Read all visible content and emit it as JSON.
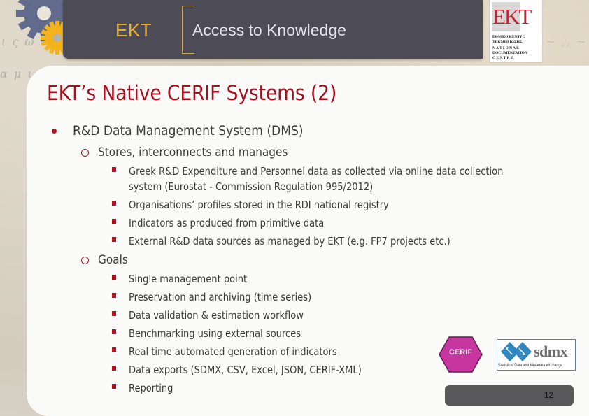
{
  "header": {
    "org_short": "EKT",
    "tagline": "Access to Knowledge"
  },
  "logo": {
    "mark": "EKT",
    "lines": [
      "ΕΘΝΙΚΟ ΚΕΝΤΡΟ",
      "ΤΕΚΜΗΡΙΩΣΗΣ",
      "N A T I O N A L",
      "DOCUMENTATION",
      "C E N T R E"
    ]
  },
  "slide": {
    "title": "EKT’s Native CERIF Systems (2)",
    "bullet": "R&D Data Management System (DMS)",
    "sections": [
      {
        "heading": "Stores, interconnects and manages",
        "items": [
          "Greek R&D Expenditure and Personnel data as collected via online data collection",
          "system (Eurostat - Commission Regulation 995/2012)",
          "Organisations’ profiles stored in the RDI national registry",
          "Indicators as produced from primitive data",
          "External R&D data sources as managed by EKT (e.g. FP7 projects etc.)"
        ]
      },
      {
        "heading": "Goals",
        "items": [
          "Single management point",
          "Preservation and archiving (time series)",
          "Data validation & estimation workflow",
          "Benchmarking using external sources",
          "Real time automated generation of indicators",
          "Data exports (SDMX, CSV, Excel, JSON, CERIF-XML)",
          "Reporting"
        ]
      }
    ]
  },
  "badges": {
    "cerif": "CERIF",
    "sdmx_word": "sdmx",
    "sdmx_sub": "Statistical Data and Metadata eXchange"
  },
  "footer": {
    "page_number": "12"
  },
  "colors": {
    "header_bg": "#4d4b55",
    "accent_gold": "#e9ae2c",
    "title_red": "#a3111f",
    "cerif_magenta": "#c7369f",
    "sdmx_blue": "#2e86c1",
    "footer_bg": "#59595b"
  }
}
